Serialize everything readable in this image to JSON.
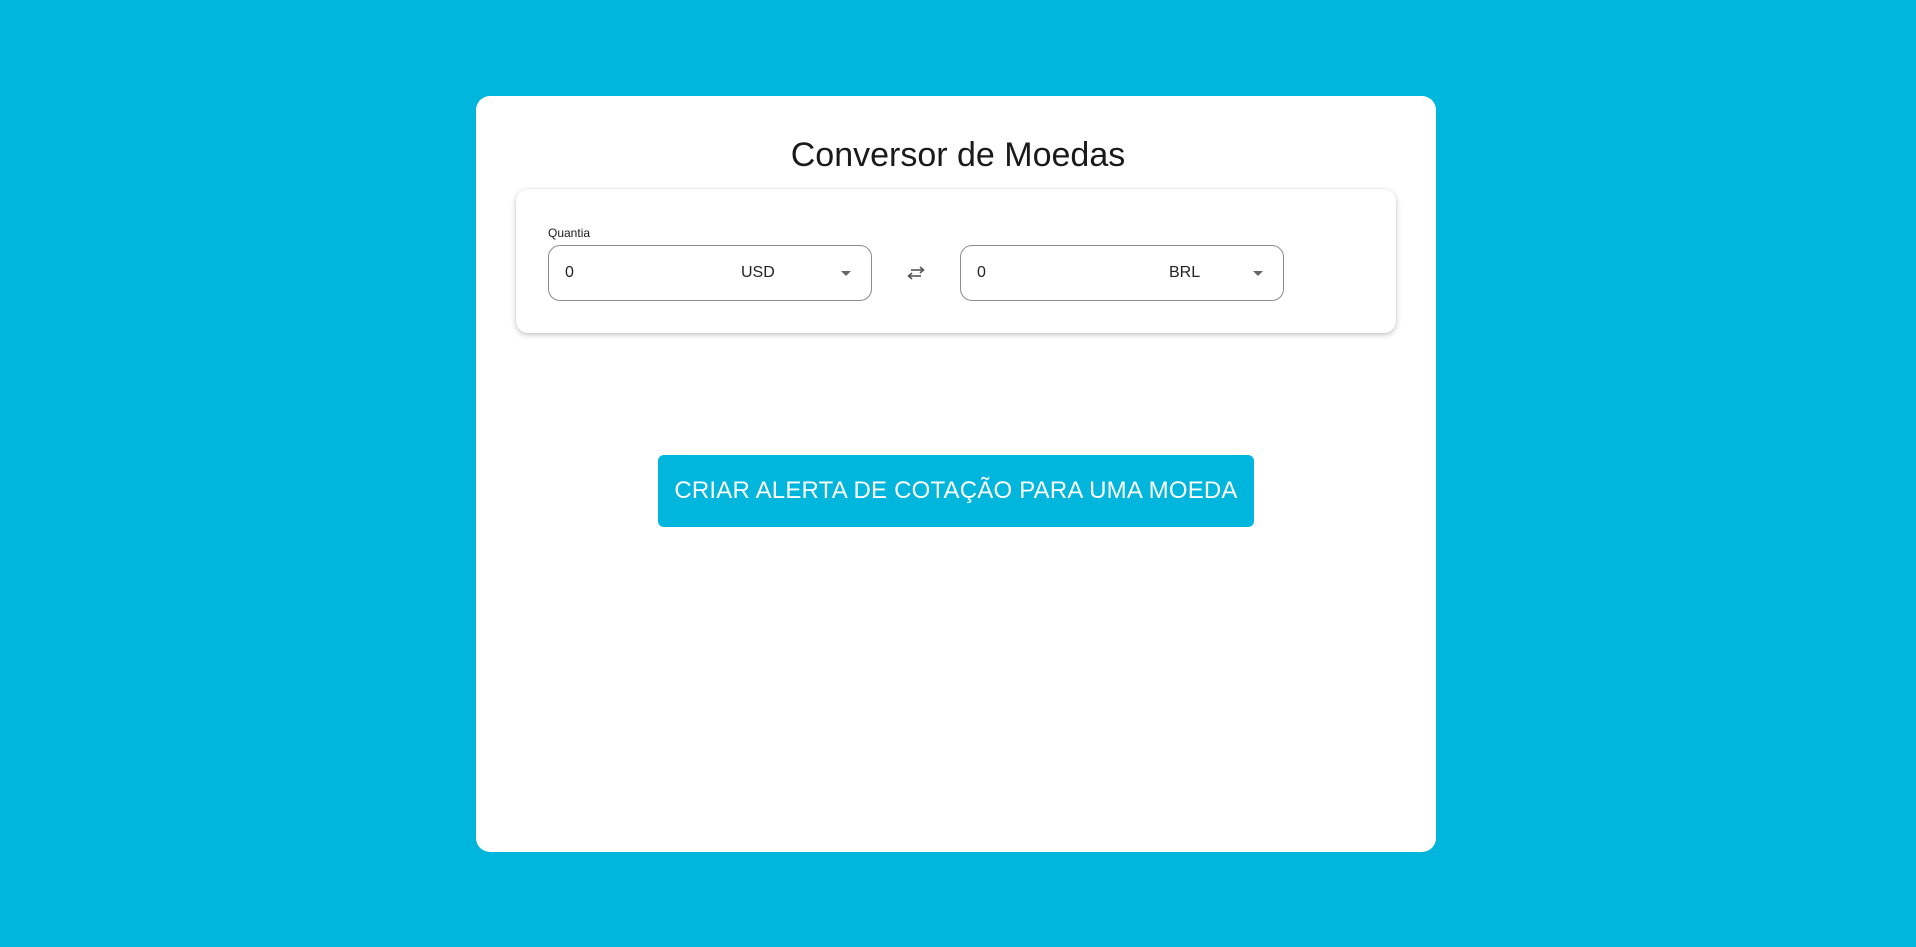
{
  "app": {
    "title": "Conversor de Moedas"
  },
  "converter": {
    "amount_label": "Quantia",
    "from": {
      "amount": "0",
      "currency": "USD"
    },
    "to": {
      "amount": "0",
      "currency": "BRL"
    },
    "swap_icon": "swap-arrows-icon"
  },
  "actions": {
    "create_alert_label": "CRIAR ALERTA DE COTAÇÃO PARA UMA MOEDA"
  },
  "colors": {
    "background": "#00b6dc",
    "card": "#ffffff",
    "button": "#00b6dc",
    "button_text": "#ffffff"
  }
}
